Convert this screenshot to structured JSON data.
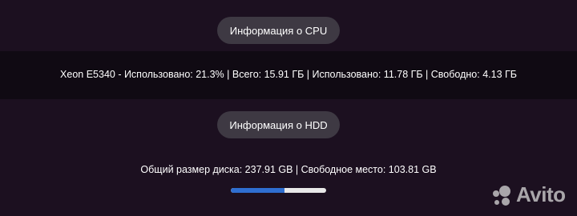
{
  "cpu_section": {
    "button_label": "Информация о CPU",
    "info_text": "Xeon E5340 - Использовано: 21.3% | Всего: 15.91 ГБ | Использовано: 11.78 ГБ | Свободно: 4.13 ГБ"
  },
  "hdd_section": {
    "button_label": "Информация о HDD",
    "info_text": "Общий размер диска: 237.91 GB | Свободное место: 103.81 GB",
    "usage_fraction": 0.564
  },
  "watermark": {
    "text": "Avito"
  },
  "colors": {
    "progress_fill": "#2f6fd1",
    "progress_track": "#e8e8e8",
    "button_bg": "#3e3943"
  }
}
